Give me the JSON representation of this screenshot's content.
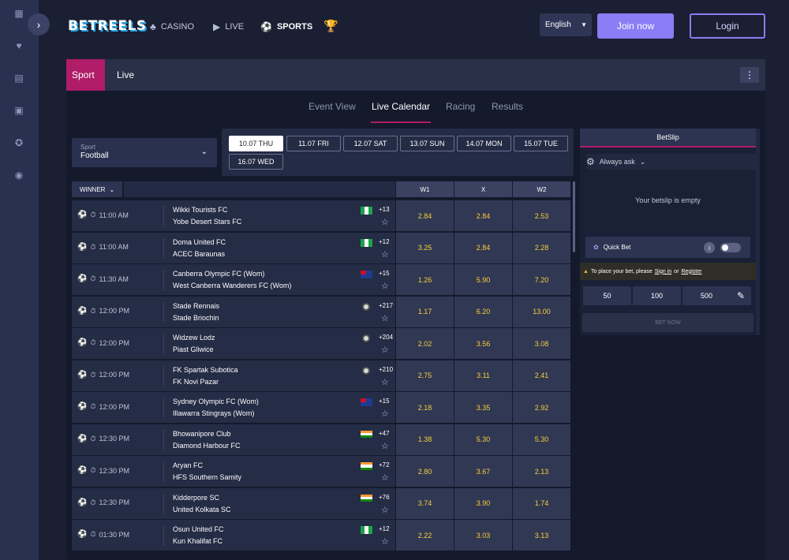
{
  "header": {
    "logo": "BETREELS",
    "nav": [
      {
        "label": "CASINO",
        "icon": "clubs-icon"
      },
      {
        "label": "LIVE",
        "icon": "live-icon"
      },
      {
        "label": "SPORTS",
        "icon": "soccer-ball-icon"
      }
    ],
    "language": "English",
    "join_label": "Join now",
    "login_label": "Login"
  },
  "rail_icons": [
    "dashboard-icon",
    "heart-icon",
    "building-icon",
    "gift-icon",
    "settings-icon",
    "chat-icon"
  ],
  "tabs": {
    "sport": "Sport",
    "live": "Live"
  },
  "subtabs": [
    "Event View",
    "Live Calendar",
    "Racing",
    "Results"
  ],
  "sport_select": {
    "label": "Sport",
    "value": "Football"
  },
  "dates": [
    "10.07 THU",
    "11.07 FRI",
    "12.07 SAT",
    "13.07 SUN",
    "14.07 MON",
    "15.07 TUE",
    "16.07 WED"
  ],
  "table": {
    "market": "WINNER",
    "cols": [
      "W1",
      "X",
      "W2"
    ],
    "rows": [
      {
        "time": "11:00 AM",
        "t1": "Wikki Tourists FC",
        "t2": "Yobe Desert Stars FC",
        "flag": "ng",
        "more": "+13",
        "o": [
          "2.84",
          "2.84",
          "2.53"
        ]
      },
      {
        "time": "11:00 AM",
        "t1": "Doma United FC",
        "t2": "ACEC Baraunas",
        "flag": "ng",
        "more": "+12",
        "o": [
          "3.25",
          "2.84",
          "2.28"
        ]
      },
      {
        "time": "11:30 AM",
        "t1": "Canberra Olympic FC (Wom)",
        "t2": "West Canberra Wanderers FC (Wom)",
        "flag": "au",
        "more": "+15",
        "o": [
          "1.26",
          "5.90",
          "7.20"
        ]
      },
      {
        "time": "12:00 PM",
        "t1": "Stade Rennais",
        "t2": "Stade Briochin",
        "flag": "int",
        "more": "+217",
        "o": [
          "1.17",
          "6.20",
          "13.00"
        ]
      },
      {
        "time": "12:00 PM",
        "t1": "Widzew Lodz",
        "t2": "Piast Gliwice",
        "flag": "int",
        "more": "+204",
        "o": [
          "2.02",
          "3.56",
          "3.08"
        ]
      },
      {
        "time": "12:00 PM",
        "t1": "FK Spartak Subotica",
        "t2": "FK Novi Pazar",
        "flag": "int",
        "more": "+210",
        "o": [
          "2.75",
          "3.11",
          "2.41"
        ]
      },
      {
        "time": "12:00 PM",
        "t1": "Sydney Olympic FC (Wom)",
        "t2": "Illawarra Stingrays (Wom)",
        "flag": "au",
        "more": "+15",
        "o": [
          "2.18",
          "3.35",
          "2.92"
        ]
      },
      {
        "time": "12:30 PM",
        "t1": "Bhowanipore Club",
        "t2": "Diamond Harbour FC",
        "flag": "in",
        "more": "+47",
        "o": [
          "1.38",
          "5.30",
          "5.30"
        ]
      },
      {
        "time": "12:30 PM",
        "t1": "Aryan FC",
        "t2": "HFS Southern Samity",
        "flag": "in",
        "more": "+72",
        "o": [
          "2.80",
          "3.67",
          "2.13"
        ]
      },
      {
        "time": "12:30 PM",
        "t1": "Kidderpore SC",
        "t2": "United Kolkata SC",
        "flag": "in",
        "more": "+76",
        "o": [
          "3.74",
          "3.90",
          "1.74"
        ]
      },
      {
        "time": "01:30 PM",
        "t1": "Osun United FC",
        "t2": "Kun Khalifat FC",
        "flag": "ng",
        "more": "+12",
        "o": [
          "2.22",
          "3.03",
          "3.13"
        ]
      }
    ]
  },
  "betslip": {
    "title": "BetSlip",
    "mode": "Always ask",
    "empty": "Your betslip is empty",
    "quick_bet": "Quick Bet",
    "warn_pre": "To place your bet, please",
    "signin": "Sign in",
    "or": "or",
    "register": "Register",
    "amounts": [
      "50",
      "100",
      "500"
    ],
    "bet_now": "BET NOW"
  },
  "colors": {
    "accent": "#b01c67",
    "primary": "#8a7df5",
    "odds": "#f3d13a"
  }
}
